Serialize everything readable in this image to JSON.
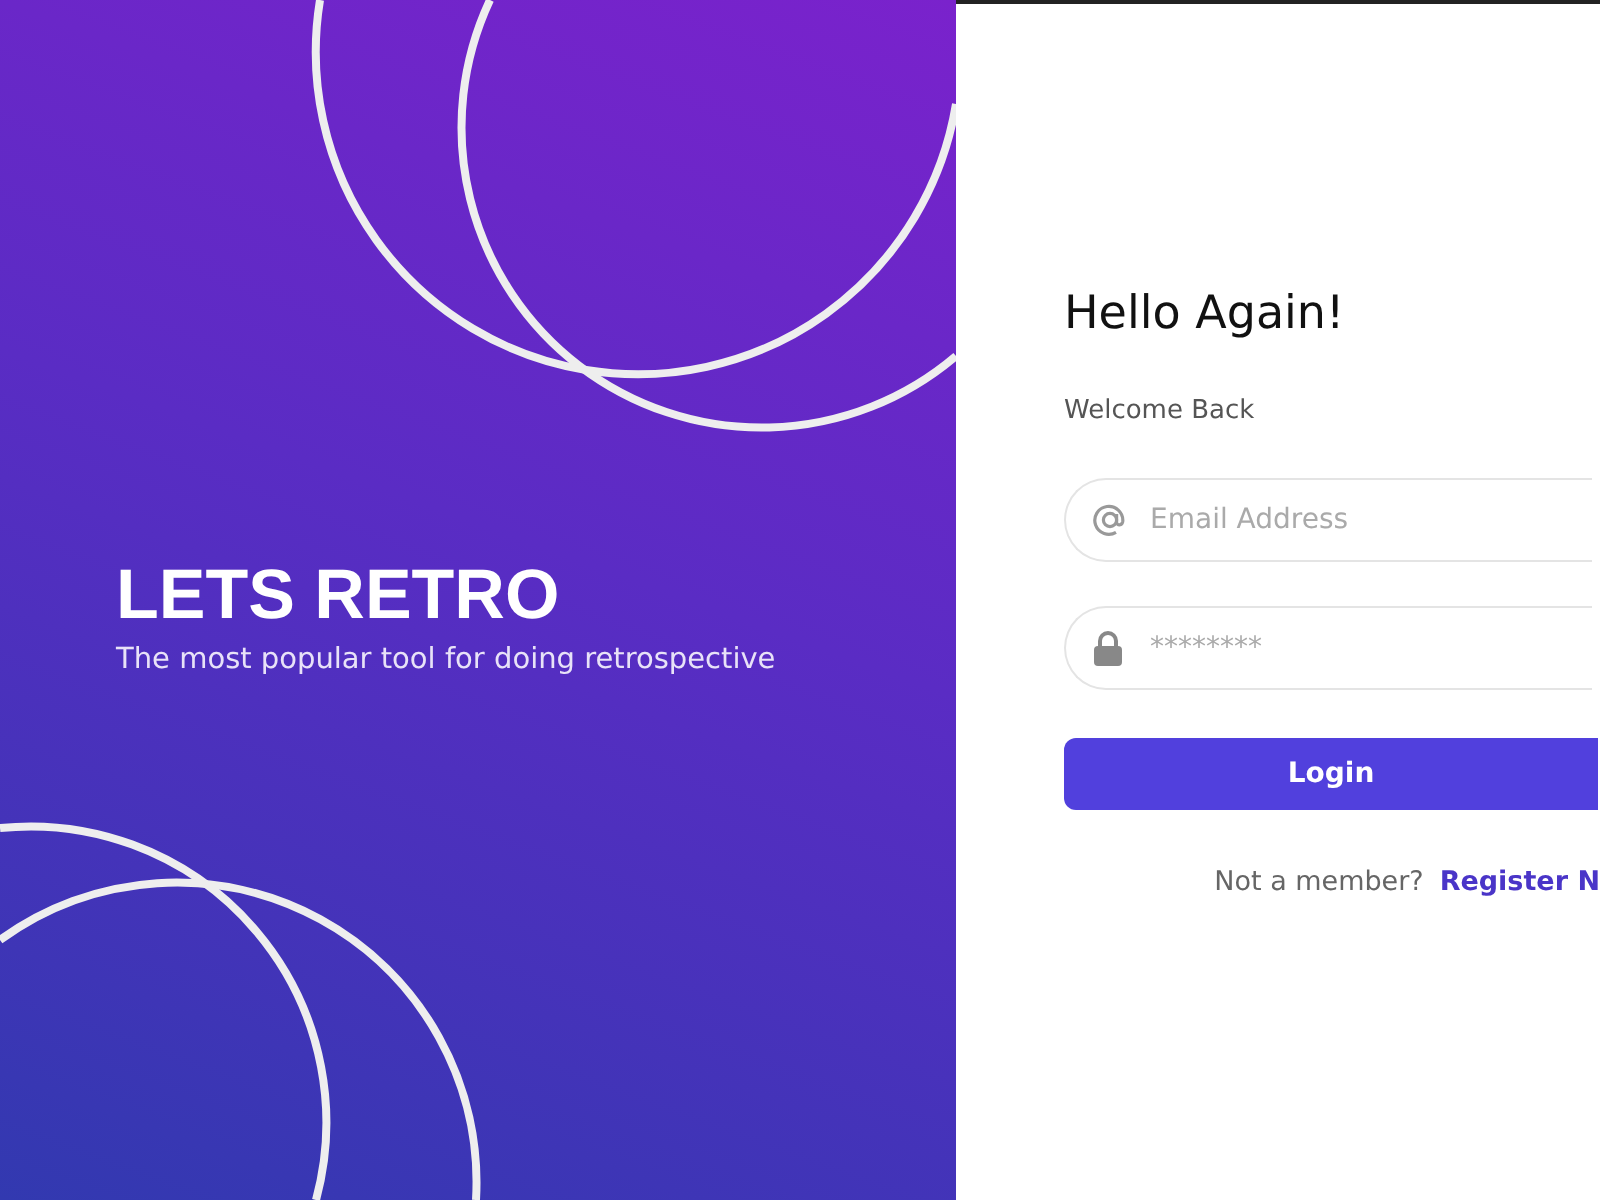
{
  "brand": {
    "title": "LETS RETRO",
    "tagline": "The most popular tool for doing retrospective"
  },
  "form": {
    "heading": "Hello Again!",
    "subheading": "Welcome Back",
    "fields": [
      {
        "kind": "email",
        "placeholder": "Email Address"
      },
      {
        "kind": "password",
        "placeholder": "********"
      }
    ],
    "submit": "Login",
    "footer": {
      "prompt": "Not a member?",
      "link": "Register N"
    }
  }
}
